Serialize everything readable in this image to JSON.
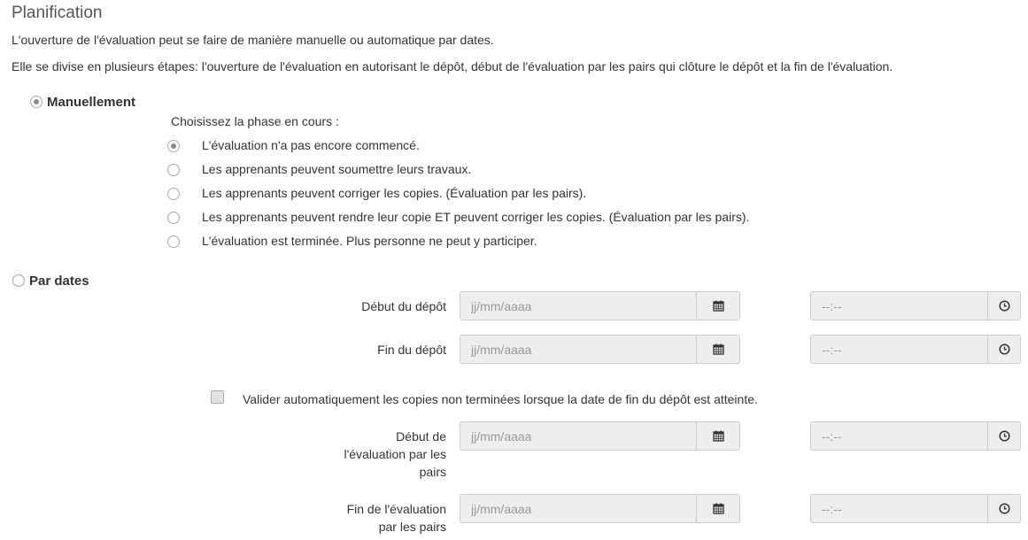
{
  "section": {
    "title": "Planification",
    "intro_1": "L'ouverture de l'évaluation peut se faire de manière manuelle ou automatique par dates.",
    "intro_2": "Elle se divise en plusieurs étapes: l'ouverture de l'évaluation en autorisant le dépôt, début de l'évaluation par les pairs qui clôture le dépôt et la fin de l'évaluation."
  },
  "mode": {
    "manual_label": "Manuellement",
    "manual_checked": true,
    "dates_label": "Par dates",
    "dates_checked": false
  },
  "phase": {
    "prompt": "Choisissez la phase en cours :",
    "options": [
      {
        "label": "L'évaluation n'a pas encore commencé.",
        "checked": true
      },
      {
        "label": "Les apprenants peuvent soumettre leurs travaux.",
        "checked": false
      },
      {
        "label": "Les apprenants peuvent corriger les copies. (Évaluation par les pairs).",
        "checked": false
      },
      {
        "label": "Les apprenants peuvent rendre leur copie ET peuvent corriger les copies. (Évaluation par les pairs).",
        "checked": false
      },
      {
        "label": "L'évaluation est terminée. Plus personne ne peut y participer.",
        "checked": false
      }
    ]
  },
  "schedule": {
    "date_placeholder": "jj/mm/aaaa",
    "time_placeholder": "--:--",
    "rows": [
      {
        "label_lines": [
          "Début du dépôt"
        ]
      },
      {
        "label_lines": [
          "Fin du dépôt"
        ]
      },
      {
        "label_lines": [
          "Début de",
          "l'évaluation par les",
          "pairs"
        ]
      },
      {
        "label_lines": [
          "Fin de l'évaluation",
          "par les pairs"
        ]
      }
    ],
    "auto_validate": {
      "label": "Valider automatiquement les copies non terminées lorsque la date de fin du dépôt est atteinte.",
      "checked": false
    }
  },
  "icons": {
    "calendar": "calendar-icon",
    "clock": "clock-icon"
  }
}
